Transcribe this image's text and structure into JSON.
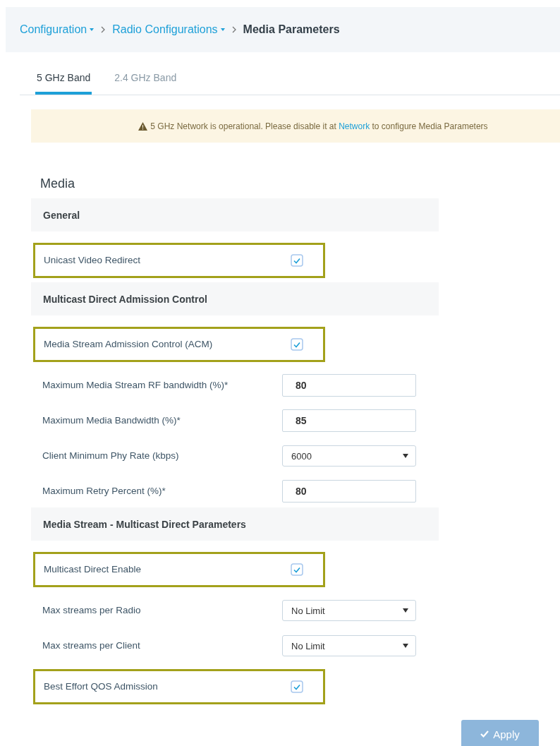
{
  "breadcrumb": [
    {
      "label": "Configuration",
      "kind": "link",
      "dropdown": true
    },
    {
      "label": "Radio Configurations",
      "kind": "link",
      "dropdown": true
    },
    {
      "label": "Media Parameters",
      "kind": "current",
      "dropdown": false
    }
  ],
  "tabs": [
    {
      "label": "5 GHz Band",
      "selected": true
    },
    {
      "label": "2.4 GHz Band",
      "selected": false
    }
  ],
  "alert": {
    "before": "5 GHz Network is operational. Please disable it at",
    "link": "Network",
    "after": "to configure Media Parameters"
  },
  "title": "Media",
  "rows": [
    {
      "kind": "section",
      "label": "General"
    },
    {
      "kind": "checkbox",
      "label": "Unicast Video Redirect",
      "checked": true,
      "highlighted": true
    },
    {
      "kind": "section",
      "label": "Multicast Direct Admission Control"
    },
    {
      "kind": "checkbox",
      "label": "Media Stream Admission Control (ACM)",
      "checked": true,
      "highlighted": true
    },
    {
      "kind": "input",
      "label": "Maximum Media Stream RF bandwidth (%)*",
      "value": "80"
    },
    {
      "kind": "input",
      "label": "Maximum Media Bandwidth (%)*",
      "value": "85"
    },
    {
      "kind": "select",
      "label": "Client Minimum Phy Rate (kbps)",
      "value": "6000"
    },
    {
      "kind": "input",
      "label": "Maximum Retry Percent (%)*",
      "value": "80"
    },
    {
      "kind": "section",
      "label": "Media Stream - Multicast Direct Parameters"
    },
    {
      "kind": "checkbox",
      "label": "Multicast Direct Enable",
      "checked": true,
      "highlighted": true
    },
    {
      "kind": "select",
      "label": "Max streams per Radio",
      "value": "No Limit"
    },
    {
      "kind": "select",
      "label": "Max streams per Client",
      "value": "No Limit"
    },
    {
      "kind": "checkbox",
      "label": "Best Effort QOS Admission",
      "checked": true,
      "highlighted": true
    }
  ],
  "apply": {
    "label": "Apply",
    "disabled": true
  }
}
